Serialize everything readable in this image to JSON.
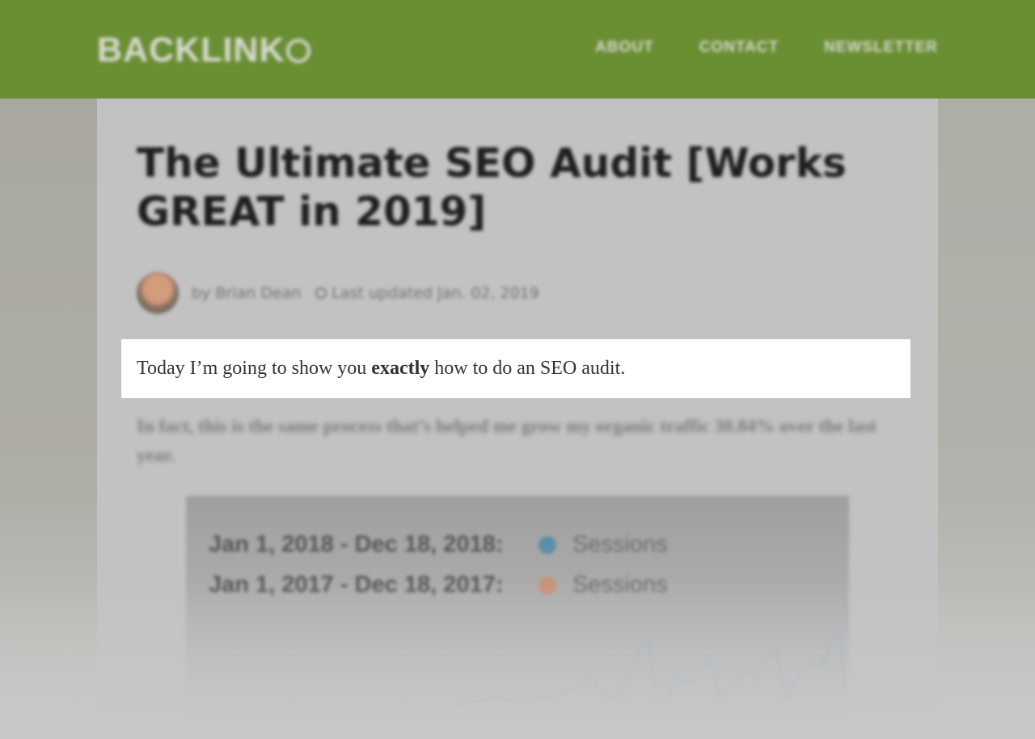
{
  "header": {
    "logo_text": "BACKLINK",
    "logo_last_letter": "O",
    "nav": [
      "ABOUT",
      "CONTACT",
      "NEWSLETTER"
    ],
    "background_color": "#6a8f33"
  },
  "article": {
    "title": "The Ultimate SEO Audit [Works GREAT in 2019]",
    "author": "by Brian Dean",
    "updated": "Last updated Jan. 02, 2019",
    "highlight": {
      "before": "Today I’m going to show you ",
      "bold": "exactly",
      "after": " how to do an SEO audit."
    },
    "paragraph_2": "In fact, this is the same process that’s helped me grow my organic traffic 30.84% over the last year."
  },
  "chart": {
    "legend": [
      {
        "range": "Jan 1, 2018 - Dec 18, 2018:",
        "series": "Sessions",
        "color": "#5b8ea8"
      },
      {
        "range": "Jan 1, 2017 - Dec 18, 2017:",
        "series": "Sessions",
        "color": "#c9917a"
      }
    ]
  }
}
